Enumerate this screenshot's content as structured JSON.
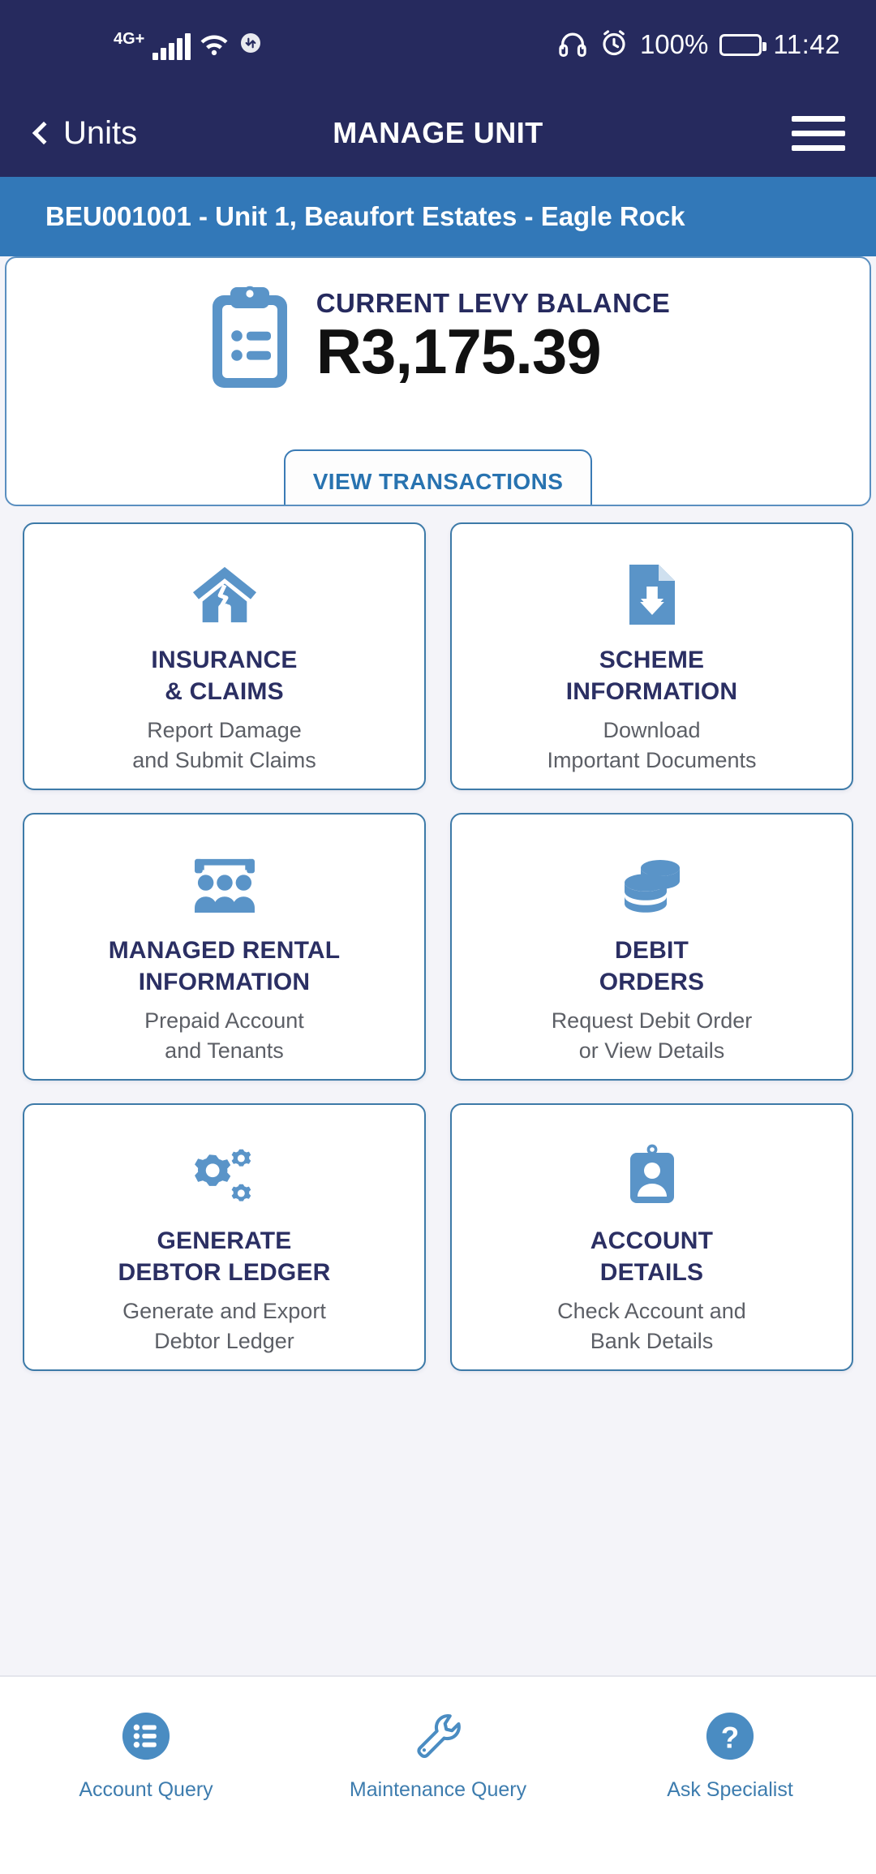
{
  "statusbar": {
    "network": "4G+",
    "battery_percent": "100%",
    "time": "11:42",
    "icons": [
      "signal-bars-icon",
      "wifi-icon",
      "data-sync-icon",
      "headphones-icon",
      "alarm-clock-icon",
      "battery-icon"
    ]
  },
  "navbar": {
    "back_label": "Units",
    "title": "MANAGE UNIT",
    "menu_icon": "hamburger-menu-icon"
  },
  "subheader": {
    "unit_description": "BEU001001 - Unit 1, Beaufort Estates - Eagle Rock"
  },
  "balance_card": {
    "icon": "clipboard-list-icon",
    "label": "CURRENT LEVY BALANCE",
    "amount": "R3,175.39",
    "button_label": "VIEW TRANSACTIONS"
  },
  "tiles": [
    {
      "icon": "house-damage-icon",
      "title_line1": "INSURANCE",
      "title_line2": "& CLAIMS",
      "sub_line1": "Report Damage",
      "sub_line2": "and Submit Claims"
    },
    {
      "icon": "file-download-icon",
      "title_line1": "SCHEME",
      "title_line2": "INFORMATION",
      "sub_line1": "Download",
      "sub_line2": "Important Documents"
    },
    {
      "icon": "people-group-icon",
      "title_line1": "MANAGED RENTAL",
      "title_line2": "INFORMATION",
      "sub_line1": "Prepaid Account",
      "sub_line2": "and Tenants"
    },
    {
      "icon": "coins-stack-icon",
      "title_line1": "DEBIT",
      "title_line2": "ORDERS",
      "sub_line1": "Request Debit Order",
      "sub_line2": "or View Details"
    },
    {
      "icon": "gears-icon",
      "title_line1": "GENERATE",
      "title_line2": "DEBTOR LEDGER",
      "sub_line1": "Generate and Export",
      "sub_line2": "Debtor Ledger"
    },
    {
      "icon": "id-badge-icon",
      "title_line1": "ACCOUNT",
      "title_line2": "DETAILS",
      "sub_line1": "Check Account and",
      "sub_line2": "Bank Details"
    }
  ],
  "bottomnav": [
    {
      "icon": "list-circle-icon",
      "label": "Account Query"
    },
    {
      "icon": "wrench-icon",
      "label": "Maintenance Query"
    },
    {
      "icon": "question-circle-icon",
      "label": "Ask Specialist"
    }
  ],
  "colors": {
    "navy": "#262a5e",
    "blue_band": "#3278b8",
    "icon_blue": "#5a94c8",
    "accent_blue": "#2873b0",
    "page_bg": "#f4f4f9",
    "tile_border": "#3d7aa8",
    "title_navy": "#2b2f63",
    "sub_gray": "#5c5f66"
  }
}
